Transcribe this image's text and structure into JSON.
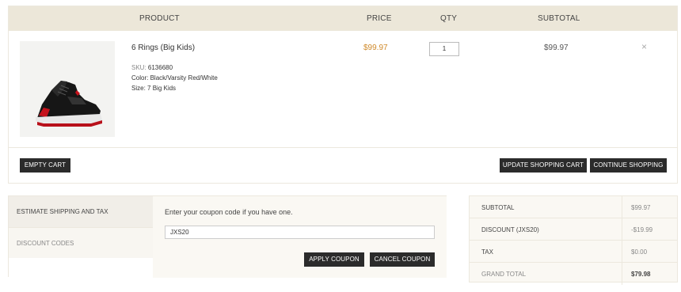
{
  "cart": {
    "headers": {
      "product": "PRODUCT",
      "price": "PRICE",
      "qty": "QTY",
      "subtotal": "SUBTOTAL"
    },
    "item": {
      "name": "6 Rings (Big Kids)",
      "sku_label": "SKU:",
      "sku": "6136680",
      "color_label": "Color:",
      "color": "Black/Varsity Red/White",
      "size_label": "Size:",
      "size": "7 Big Kids",
      "price": "$99.97",
      "qty": "1",
      "subtotal": "$99.97",
      "remove_icon": "×"
    },
    "buttons": {
      "empty": "EMPTY CART",
      "update": "UPDATE SHOPPING CART",
      "continue": "CONTINUE SHOPPING"
    }
  },
  "panel": {
    "tabs": [
      "ESTIMATE SHIPPING AND TAX",
      "DISCOUNT CODES"
    ],
    "coupon_prompt": "Enter your coupon code if you have one.",
    "coupon_value": "JXS20",
    "apply": "APPLY COUPON",
    "cancel": "CANCEL COUPON"
  },
  "totals": [
    {
      "label": "SUBTOTAL",
      "value": "$99.97"
    },
    {
      "label": "DISCOUNT (JXS20)",
      "value": "-$19.99"
    },
    {
      "label": "TAX",
      "value": "$0.00"
    },
    {
      "label": "GRAND TOTAL",
      "value": "$79.98"
    }
  ],
  "colors": {
    "header_bg": "#ece7d9",
    "price_accent": "#d08a2a",
    "button_bg": "#2b2b2b"
  }
}
